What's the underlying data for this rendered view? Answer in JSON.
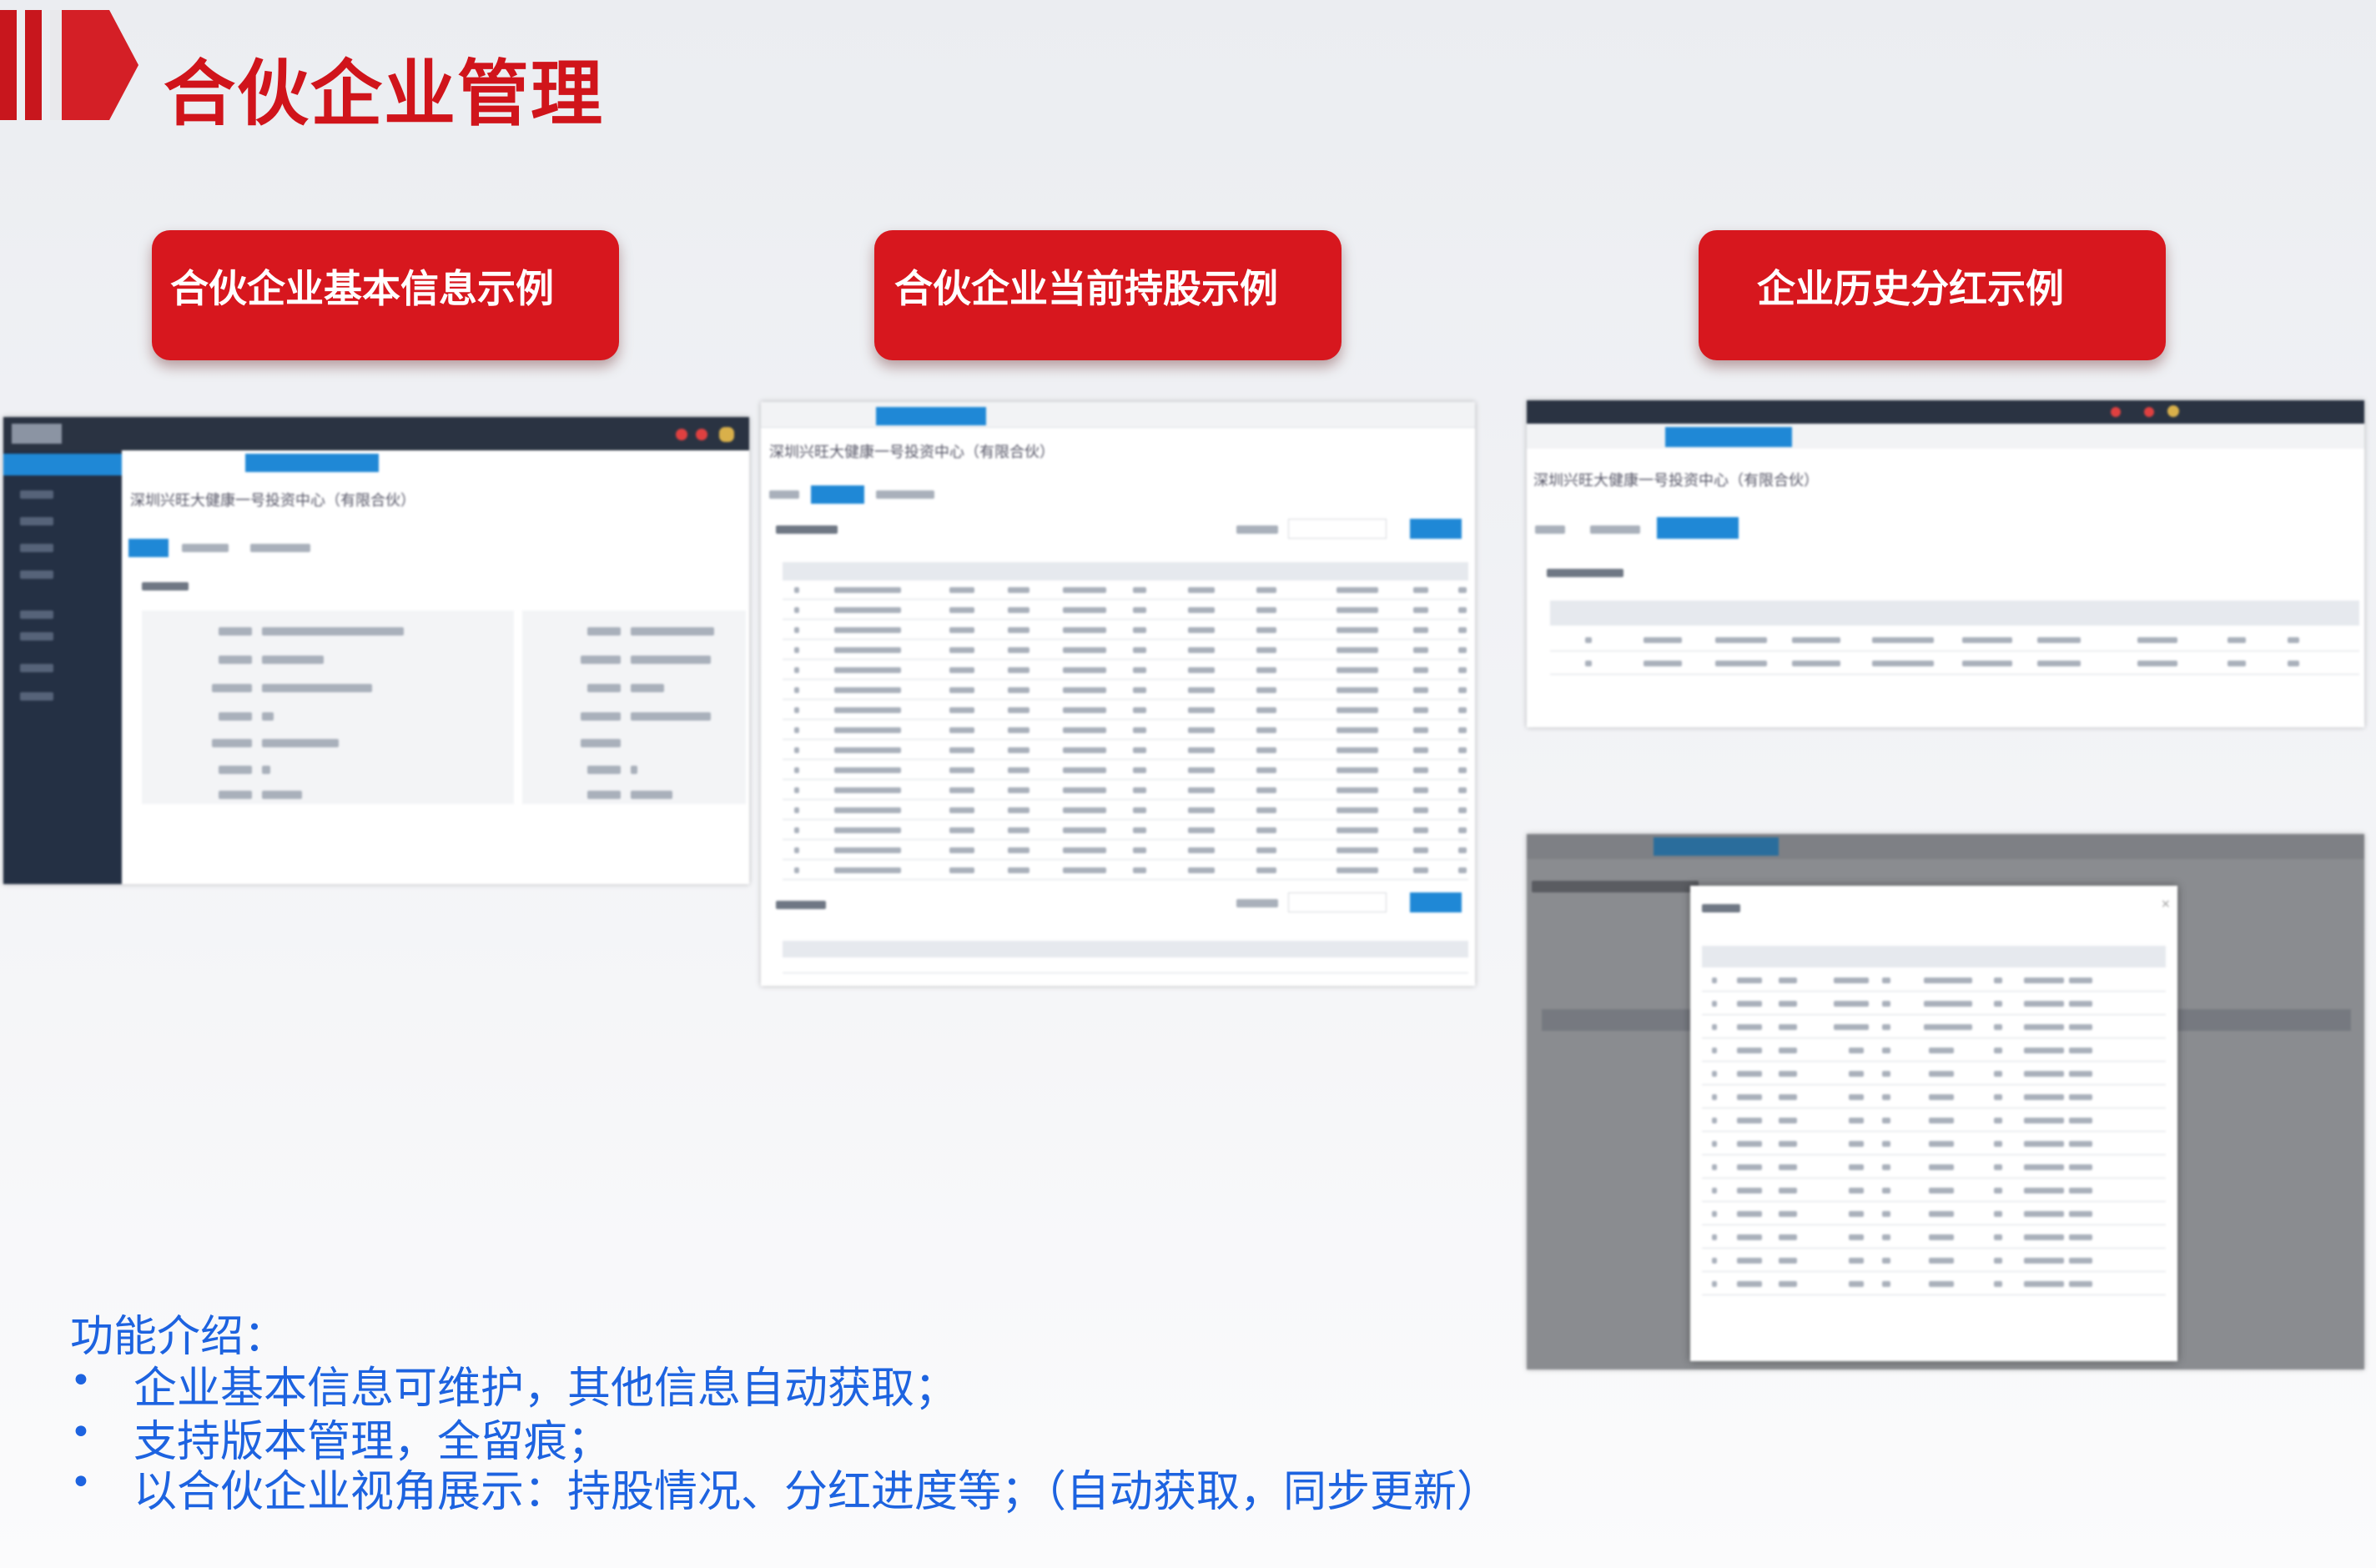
{
  "header": {
    "title": "合伙企业管理"
  },
  "labels": {
    "basic_info": "合伙企业基本信息示例",
    "holdings": "合伙企业当前持股示例",
    "dividends": "企业历史分红示例"
  },
  "screens": {
    "company_name": "深圳兴旺大健康一号投资中心（有限合伙）"
  },
  "intro": {
    "heading": "功能介绍：",
    "bullets": [
      "企业基本信息可维护，其他信息自动获取；",
      "支持版本管理，全留痕；",
      "以合伙企业视角展示：持股情况、分红进度等；（自动获取，同步更新）"
    ]
  },
  "colors": {
    "brand_red": "#d7171e",
    "intro_blue": "#1d63e0",
    "ui_blue": "#1f88d6"
  }
}
